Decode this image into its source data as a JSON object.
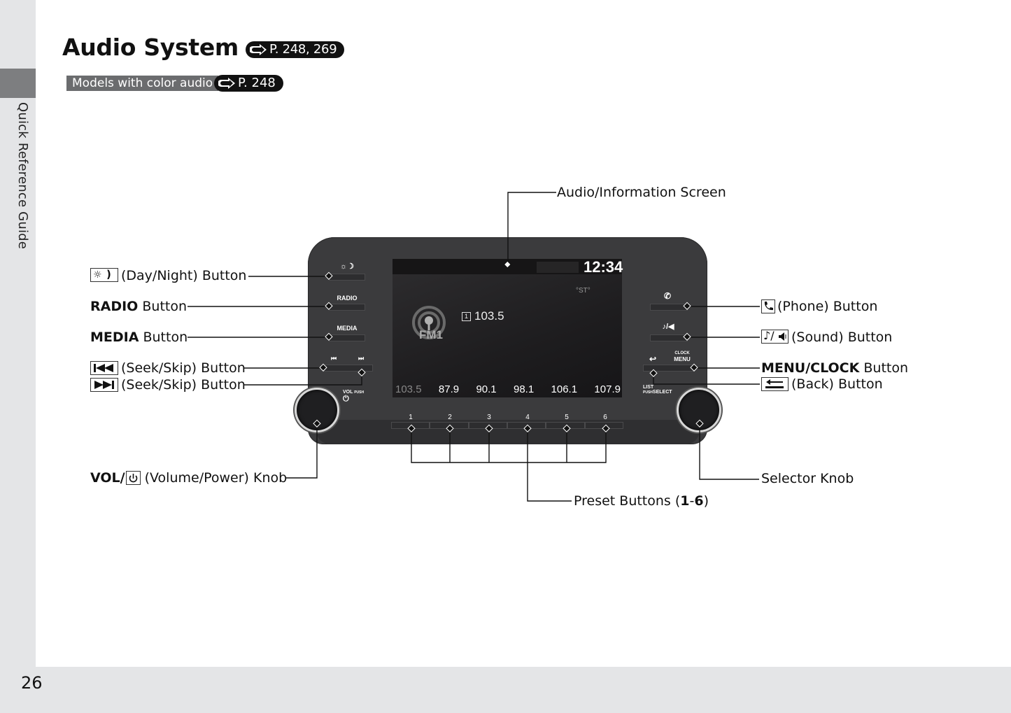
{
  "sidebar": {
    "section_label": "Quick Reference Guide"
  },
  "header": {
    "title": "Audio System",
    "title_ref": "P. 248, 269",
    "model_note": "Models with color audio",
    "model_ref": "P. 248"
  },
  "callouts": {
    "screen": "Audio/Information Screen",
    "day_night": "(Day/Night) Button",
    "radio_bold": "RADIO",
    "radio_rest": " Button",
    "media_bold": "MEDIA",
    "media_rest": " Button",
    "seek_back": "(Seek/Skip) Button",
    "seek_fwd": "(Seek/Skip) Button",
    "vol_bold": "VOL/",
    "vol_rest": " (Volume/Power) Knob",
    "phone": "(Phone) Button",
    "sound": "(Sound) Button",
    "menu_bold": "MENU/CLOCK",
    "menu_rest": " Button",
    "back": "(Back) Button",
    "selector": "Selector Knob",
    "presets_text": "Preset Buttons (",
    "presets_bold": "1",
    "presets_dash": "-",
    "presets_bold2": "6",
    "presets_close": ")"
  },
  "unit": {
    "clock": "12:34",
    "stereo": "°ST°",
    "preset_no": "1",
    "frequency": "103.5",
    "band": "FM1",
    "preset_freqs": [
      "103.5",
      "87.9",
      "90.1",
      "98.1",
      "106.1",
      "107.9"
    ],
    "preset_numbers": [
      "1",
      "2",
      "3",
      "4",
      "5",
      "6"
    ],
    "labels": {
      "radio": "RADIO",
      "media": "MEDIA",
      "vol": "VOL",
      "push": "PUSH",
      "clock": "CLOCK",
      "menu": "MENU",
      "list": "LIST",
      "push_select": "PUSH",
      "select": "SELECT"
    }
  },
  "footer": {
    "page_number": "26"
  }
}
